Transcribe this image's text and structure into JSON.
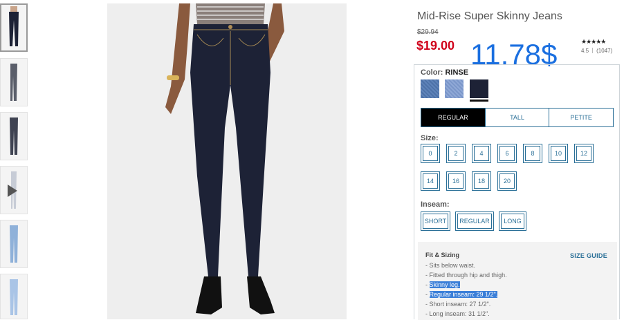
{
  "thumbnails": [
    {
      "name": "thumb-front",
      "active": true
    },
    {
      "name": "thumb-side"
    },
    {
      "name": "thumb-back"
    },
    {
      "name": "thumb-video",
      "icon": "play-icon"
    },
    {
      "name": "thumb-light-wash"
    },
    {
      "name": "thumb-light-wash-2"
    }
  ],
  "product": {
    "title": "Mid-Rise Super Skinny Jeans",
    "old_price": "$29.94",
    "price": "$19.00",
    "overlay_price": "11.78$",
    "rating": {
      "stars": "★★★★★",
      "score": "4.5",
      "count": "(1047)"
    }
  },
  "color": {
    "label": "Color:",
    "value": "RINSE",
    "swatches": [
      "medium-wash",
      "light-wash",
      "rinse"
    ],
    "selected": "rinse"
  },
  "fit_tabs": [
    {
      "label": "REGULAR",
      "selected": true
    },
    {
      "label": "TALL"
    },
    {
      "label": "PETITE"
    }
  ],
  "size": {
    "label": "Size:",
    "options": [
      "0",
      "2",
      "4",
      "6",
      "8",
      "10",
      "12",
      "14",
      "16",
      "18",
      "20"
    ]
  },
  "inseam": {
    "label": "Inseam:",
    "options": [
      "SHORT",
      "REGULAR",
      "LONG"
    ]
  },
  "fit_sizing": {
    "title": "Fit & Sizing",
    "size_guide": "SIZE GUIDE",
    "bullets": [
      {
        "dash": "- ",
        "text": "Sits below waist."
      },
      {
        "dash": "- ",
        "text": "Fitted through hip and thigh."
      },
      {
        "dash": "- ",
        "text": "Skinny leg.",
        "highlighted": true
      },
      {
        "dash": "- ",
        "text": "Regular inseam: 29 1/2\".",
        "highlighted": true
      },
      {
        "dash": "- ",
        "text": "Short inseam: 27 1/2\"."
      },
      {
        "dash": "- ",
        "text": "Long inseam: 31 1/2\"."
      }
    ]
  },
  "colors": {
    "accent": "#2a6f97",
    "price_red": "#d0021b",
    "overlay_blue": "#1a6fe0",
    "highlight": "#3b7fd8"
  }
}
